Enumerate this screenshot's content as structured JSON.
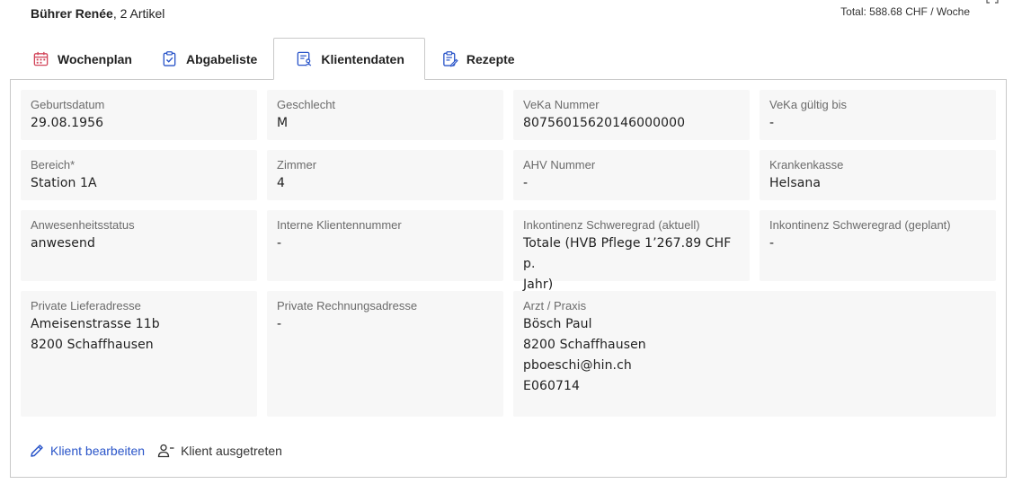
{
  "header": {
    "client_name": "Bührer Renée",
    "item_count": ", 2 Artikel",
    "total": "Total: 588.68 CHF / Woche"
  },
  "tabs": [
    {
      "label": "Wochenplan",
      "icon": "calendar-icon",
      "active": false
    },
    {
      "label": "Abgabeliste",
      "icon": "clipboard-check-icon",
      "active": false
    },
    {
      "label": "Klientendaten",
      "icon": "client-record-icon",
      "active": true
    },
    {
      "label": "Rezepte",
      "icon": "prescription-icon",
      "active": false
    }
  ],
  "fields": {
    "geburtsdatum": {
      "label": "Geburtsdatum",
      "value": "29.08.1956"
    },
    "geschlecht": {
      "label": "Geschlecht",
      "value": "M"
    },
    "veka_nummer": {
      "label": "VeKa Nummer",
      "value": "80756015620146000000"
    },
    "veka_gueltig": {
      "label": "VeKa gültig bis",
      "value": "-"
    },
    "bereich": {
      "label": "Bereich*",
      "value": "Station 1A"
    },
    "zimmer": {
      "label": "Zimmer",
      "value": "4"
    },
    "ahv_nummer": {
      "label": "AHV Nummer",
      "value": "-"
    },
    "krankenkasse": {
      "label": "Krankenkasse",
      "value": "Helsana"
    },
    "anwesenheit": {
      "label": "Anwesenheitsstatus",
      "value": "anwesend"
    },
    "interne_nummer": {
      "label": "Interne Klientennummer",
      "value": "-"
    },
    "inkontinenz_aktuell": {
      "label": "Inkontinenz Schweregrad (aktuell)",
      "value_line1": "Totale (HVB Pflege 1’267.89 CHF p.",
      "value_line2": "Jahr)"
    },
    "inkontinenz_geplant": {
      "label": "Inkontinenz Schweregrad (geplant)",
      "value": "-"
    },
    "lieferadresse": {
      "label": "Private Lieferadresse",
      "line1": "Ameisenstrasse 11b",
      "line2": "8200 Schaffhausen"
    },
    "rechnungsadresse": {
      "label": "Private Rechnungsadresse",
      "value": "-"
    },
    "arzt": {
      "label": "Arzt / Praxis",
      "line1": "Bösch Paul",
      "line2": "8200 Schaffhausen",
      "line3": "pboeschi@hin.ch",
      "line4": "E060714"
    }
  },
  "actions": {
    "edit_label": "Klient bearbeiten",
    "exit_label": "Klient ausgetreten"
  },
  "colors": {
    "accent": "#2a55c9",
    "icon_red": "#d2455a",
    "icon_blue": "#2a55c9",
    "cell_bg": "#f7f7f7",
    "border": "#c9c9c9"
  }
}
